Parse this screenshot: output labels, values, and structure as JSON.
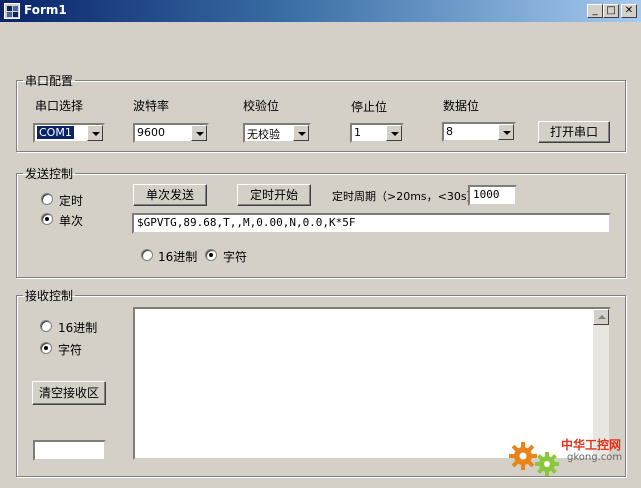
{
  "window": {
    "title": "Form1",
    "minimize": "_",
    "maximize": "□",
    "close": "✕"
  },
  "serial": {
    "legend": "串口配置",
    "port_label": "串口选择",
    "port_value": "COM1",
    "baud_label": "波特率",
    "baud_value": "9600",
    "parity_label": "校验位",
    "parity_value": "无校验",
    "stop_label": "停止位",
    "stop_value": "1",
    "data_label": "数据位",
    "data_value": "8",
    "open_button": "打开串口"
  },
  "send": {
    "legend": "发送控制",
    "mode_timed": "定时",
    "mode_single": "单次",
    "single_send_button": "单次发送",
    "timer_start_button": "定时开始",
    "period_label": "定时周期（>20ms，<30s）",
    "period_value": "1000",
    "message": "$GPVTG,89.68,T,,M,0.00,N,0.0,K*5F",
    "fmt_hex": "16进制",
    "fmt_char": "字符"
  },
  "recv": {
    "legend": "接收控制",
    "fmt_hex": "16进制",
    "fmt_char": "字符",
    "clear_button": "清空接收区",
    "count_value": "",
    "content": ""
  },
  "watermark": {
    "brand": "中华工控网",
    "site": "gkong.com"
  }
}
